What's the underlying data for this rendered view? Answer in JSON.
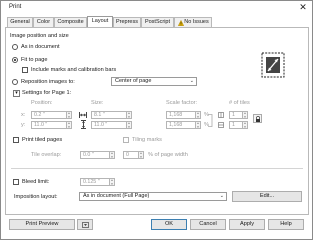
{
  "window": {
    "title": "Print",
    "close_glyph": "✕"
  },
  "tabs": [
    {
      "label": "General"
    },
    {
      "label": "Color"
    },
    {
      "label": "Composite"
    },
    {
      "label": "Layout"
    },
    {
      "label": "Prepress"
    },
    {
      "label": "PostScript"
    },
    {
      "label": "No Issues",
      "icon": "warning-icon"
    }
  ],
  "active_tab": "Layout",
  "layout": {
    "section_title": "Image position and size",
    "as_in_document": "As in document",
    "fit_to_page": "Fit to page",
    "include_marks": "Include marks and calibration bars",
    "reposition": "Reposition images to:",
    "reposition_value": "Center of page",
    "settings_for": "Settings for Page 1:",
    "col_position": "Position:",
    "col_size": "Size:",
    "col_scale": "Scale factor:",
    "col_tiles": "# of tiles",
    "x_label": "x:",
    "y_label": "y:",
    "pos_x": "0.2 \"",
    "pos_y": "11.0 \"",
    "size_w": "8.1 \"",
    "size_h": "11.0 \"",
    "scale_x": "1,168",
    "scale_y": "1,168",
    "pct": "%",
    "tiles_x": "1",
    "tiles_y": "1",
    "print_tiled": "Print tiled pages",
    "tiling_marks": "Tiling marks",
    "tile_overlap_label": "Tile overlap:",
    "tile_overlap_value": "0.0 \"",
    "tile_overlap_pct": "0",
    "pct_of_page": "% of page width",
    "bleed_limit": "Bleed limit:",
    "bleed_value": "0.125 \"",
    "imposition_label": "Imposition layout:",
    "imposition_value": "As in document (Full Page)",
    "edit_button": "Edit..."
  },
  "footer": {
    "print_preview": "Print Preview",
    "ok": "OK",
    "cancel": "Cancel",
    "apply": "Apply",
    "help": "Help"
  },
  "colors": {
    "accent": "#3c7fb1",
    "warning": "#e0b000"
  }
}
